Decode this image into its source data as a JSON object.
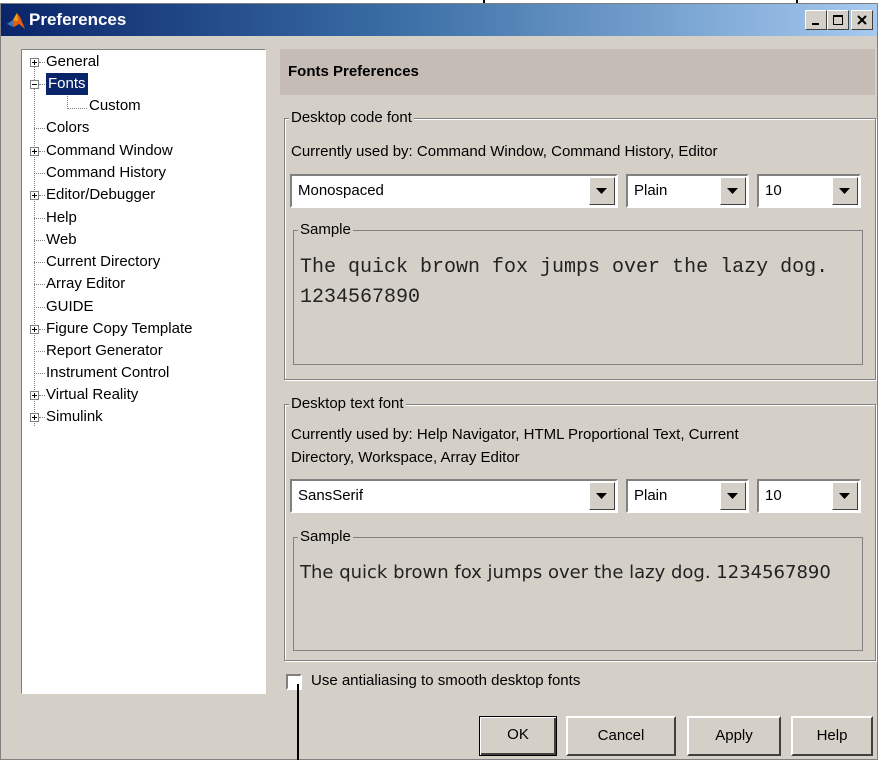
{
  "window": {
    "title": "Preferences"
  },
  "tree": {
    "items": [
      {
        "label": "General",
        "expander": "plus"
      },
      {
        "label": "Fonts",
        "expander": "minus",
        "selected": true
      },
      {
        "label": "Custom"
      },
      {
        "label": "Colors"
      },
      {
        "label": "Command Window",
        "expander": "plus"
      },
      {
        "label": "Command History"
      },
      {
        "label": "Editor/Debugger",
        "expander": "plus"
      },
      {
        "label": "Help"
      },
      {
        "label": "Web"
      },
      {
        "label": "Current Directory"
      },
      {
        "label": "Array Editor"
      },
      {
        "label": "GUIDE"
      },
      {
        "label": "Figure Copy Template",
        "expander": "plus"
      },
      {
        "label": "Report Generator"
      },
      {
        "label": "Instrument Control"
      },
      {
        "label": "Virtual Reality",
        "expander": "plus"
      },
      {
        "label": "Simulink",
        "expander": "plus"
      }
    ]
  },
  "panel": {
    "header": "Fonts Preferences",
    "code_font": {
      "legend": "Desktop code font",
      "used_by": "Currently used by: Command Window, Command History, Editor",
      "font_name": "Monospaced",
      "style": "Plain",
      "size": "10",
      "sample_legend": "Sample",
      "sample_text": "The quick brown fox jumps over the lazy dog.  1234567890"
    },
    "text_font": {
      "legend": "Desktop text font",
      "used_by_line1": "Currently used by: Help Navigator, HTML Proportional Text, Current",
      "used_by_line2": "Directory, Workspace, Array Editor",
      "font_name": "SansSerif",
      "style": "Plain",
      "size": "10",
      "sample_legend": "Sample",
      "sample_text": "The quick brown fox jumps over the lazy dog.  1234567890"
    },
    "antialias_label": "Use antialiasing to smooth desktop fonts",
    "antialias_checked": false
  },
  "buttons": {
    "ok": "OK",
    "cancel": "Cancel",
    "apply": "Apply",
    "help": "Help"
  }
}
